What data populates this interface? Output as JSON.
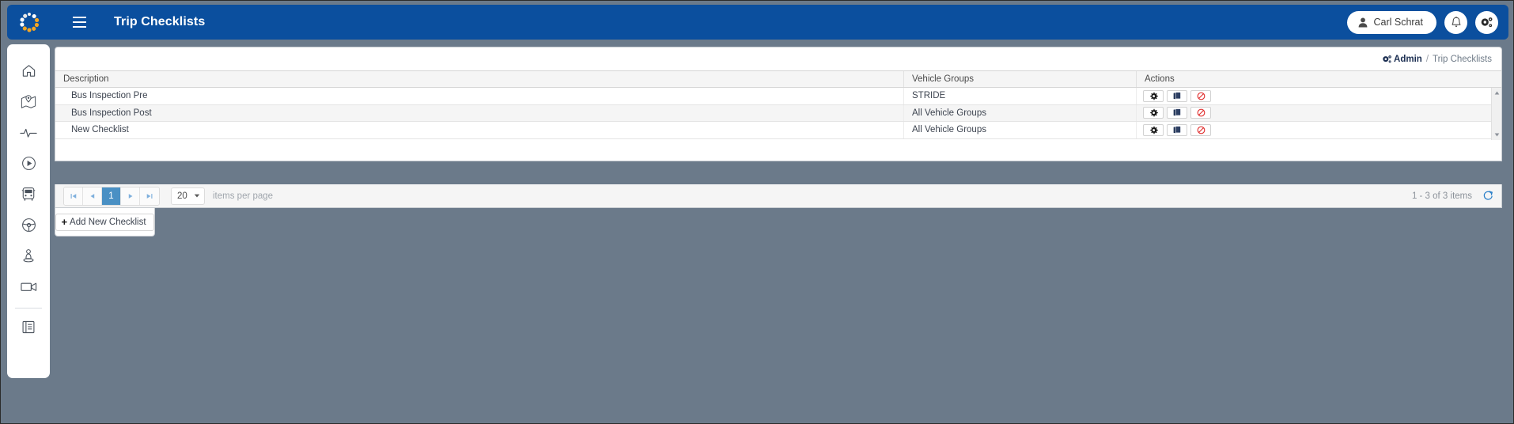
{
  "header": {
    "logo_icon": "spinner-dots-logo",
    "menu_icon": "hamburger-menu-icon",
    "title": "Trip Checklists",
    "user": {
      "name": "Carl Schrat",
      "icon": "user-person-icon"
    },
    "notification_icon": "bell-icon",
    "settings_icon": "gears-settings-icon",
    "bar_color": "#0b4f9e"
  },
  "sidebar": {
    "items": [
      {
        "icon": "home-icon",
        "name": "home"
      },
      {
        "icon": "map-pin-icon",
        "name": "map"
      },
      {
        "icon": "activity-pulse-icon",
        "name": "activity"
      },
      {
        "icon": "play-circle-icon",
        "name": "playback"
      },
      {
        "icon": "bus-icon",
        "name": "vehicles"
      },
      {
        "icon": "steering-wheel-icon",
        "name": "drivers"
      },
      {
        "icon": "person-location-icon",
        "name": "passengers"
      },
      {
        "icon": "video-camera-icon",
        "name": "video"
      }
    ],
    "footer_items": [
      {
        "icon": "book-manual-icon",
        "name": "documentation"
      }
    ]
  },
  "breadcrumb": {
    "icon": "gears-settings-icon",
    "root": "Admin",
    "separator": "/",
    "current": "Trip Checklists"
  },
  "grid": {
    "columns": [
      "Description",
      "Vehicle Groups",
      "Actions"
    ],
    "rows": [
      {
        "description": "Bus Inspection Pre",
        "vehicle_groups": "STRIDE",
        "actions": [
          "gear-icon",
          "copy-duplicate-icon",
          "disable-block-icon"
        ]
      },
      {
        "description": "Bus Inspection Post",
        "vehicle_groups": "All Vehicle Groups",
        "actions": [
          "gear-icon",
          "copy-duplicate-icon",
          "disable-block-icon"
        ]
      },
      {
        "description": "New Checklist",
        "vehicle_groups": "All Vehicle Groups",
        "actions": [
          "gear-icon",
          "copy-duplicate-icon",
          "disable-block-icon"
        ]
      }
    ],
    "scrollbar": {
      "up_icon": "caret-up-icon",
      "down_icon": "caret-down-icon"
    }
  },
  "pager": {
    "first_icon": "first-page-icon",
    "prev_icon": "prev-page-icon",
    "pages": [
      "1"
    ],
    "active_page": "1",
    "next_icon": "next-page-icon",
    "last_icon": "last-page-icon",
    "page_size": "20",
    "page_size_caret": "caret-down-icon",
    "items_per_page_label": "items per page",
    "count_label": "1 - 3 of 3 items",
    "refresh_icon": "refresh-icon",
    "accent_color": "#4a90c4"
  },
  "footer_actions": {
    "add_label": "Add New Checklist",
    "add_icon": "plus-icon"
  }
}
